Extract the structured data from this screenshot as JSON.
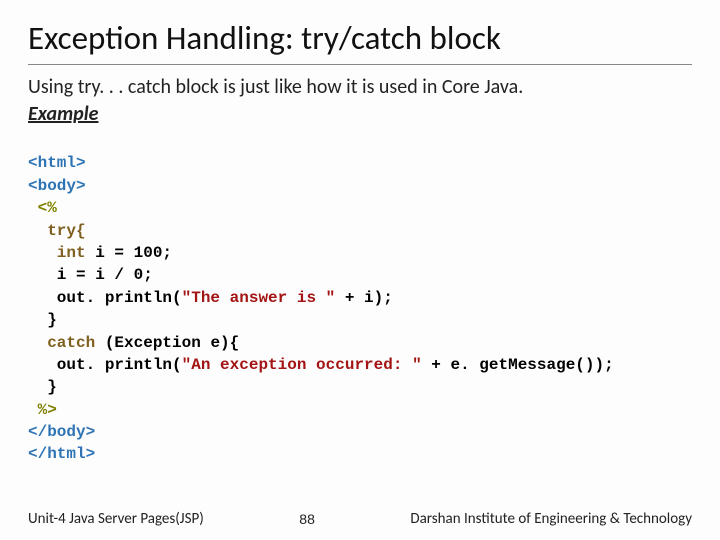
{
  "title": "Exception Handling: try/catch block",
  "description": "Using try. . . catch block is just like how it is used in Core Java.",
  "example_label": "Example",
  "code": {
    "l1": "<html>",
    "l2": "<body>",
    "l3": " <%",
    "l4": "  try{",
    "l5a": "   int",
    "l5b": " i = 100;",
    "l6": "   i = i / 0;",
    "l7a": "   out. println(",
    "l7b": "\"The answer is \"",
    "l7c": " + i);",
    "l8": "  }",
    "l9a": "  catch",
    "l9b": " (Exception e){",
    "l10a": "   out. println(",
    "l10b": "\"An exception occurred: \"",
    "l10c": " + e. getMessage());",
    "l11": "  }",
    "l12": " %>",
    "l13": "</body>",
    "l14": "</html>"
  },
  "footer": {
    "left": "Unit-4 Java Server Pages(JSP)",
    "page": "88",
    "right": "Darshan Institute of Engineering & Technology"
  }
}
